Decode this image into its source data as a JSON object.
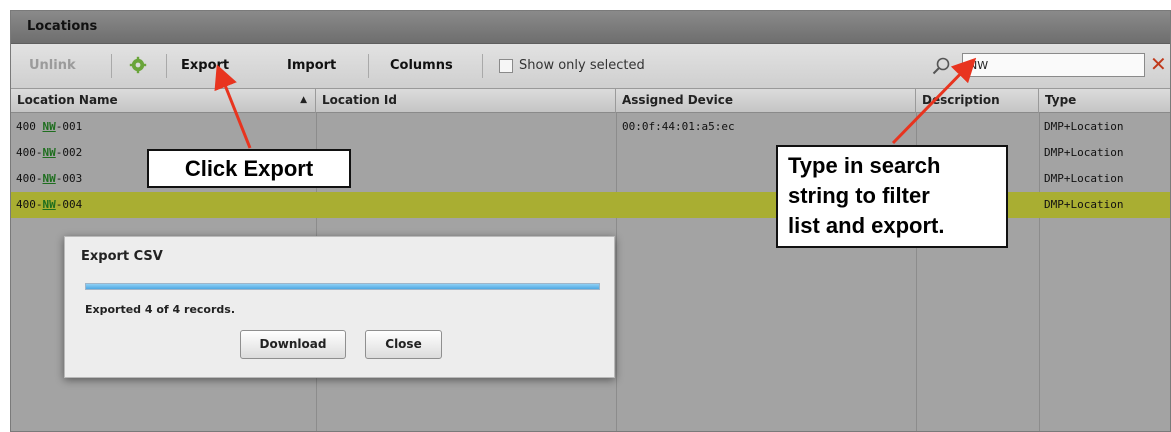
{
  "panel": {
    "title": "Locations"
  },
  "toolbar": {
    "unlink_label": "Unlink",
    "export_label": "Export",
    "import_label": "Import",
    "columns_label": "Columns",
    "show_selected_label": "Show only selected",
    "show_selected_checked": false,
    "search_value": "NW",
    "search_icon": "search-icon",
    "clear_icon": "close-icon",
    "clear_symbol": "✕"
  },
  "table": {
    "headers": [
      "Location Name",
      "Location Id",
      "Assigned Device",
      "Description",
      "Type"
    ],
    "sort": {
      "column": "Location Name",
      "direction": "ascending",
      "symbol": "▲"
    },
    "rows": [
      {
        "name_prefix": "400 ",
        "name_match": "NW",
        "name_suffix": "-001",
        "location_id": "",
        "device": "00:0f:44:01:a5:ec",
        "description": "",
        "type": "DMP+Location",
        "selected": false
      },
      {
        "name_prefix": "400-",
        "name_match": "NW",
        "name_suffix": "-002",
        "location_id": "",
        "device": "",
        "description": "",
        "type": "DMP+Location",
        "selected": false
      },
      {
        "name_prefix": "400-",
        "name_match": "NW",
        "name_suffix": "-003",
        "location_id": "",
        "device": "",
        "description": "",
        "type": "DMP+Location",
        "selected": false
      },
      {
        "name_prefix": "400-",
        "name_match": "NW",
        "name_suffix": "-004",
        "location_id": "",
        "device": "",
        "description": "",
        "type": "DMP+Location",
        "selected": true
      }
    ]
  },
  "dialog": {
    "title": "Export CSV",
    "progress_fraction": 1.0,
    "message": "Exported 4 of 4 records.",
    "download_label": "Download",
    "close_label": "Close"
  },
  "annotations": {
    "export_callout": "Click Export",
    "search_callout_lines": [
      "Type in search",
      "string to filter",
      "list and export."
    ],
    "arrow_color": "#e8341f"
  },
  "colors": {
    "selected_row": "#a9ae32",
    "match_highlight": "#1e6e1e",
    "progress": "#4fa8e2",
    "clear_icon": "#c0391b"
  }
}
